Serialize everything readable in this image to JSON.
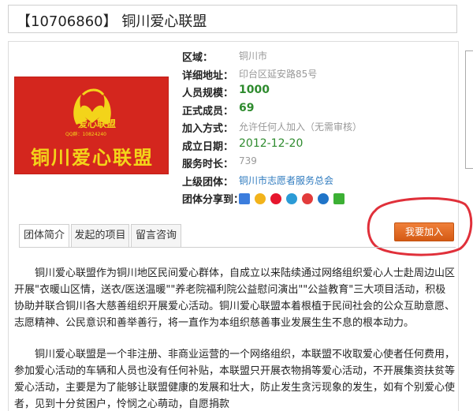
{
  "header": {
    "title": "【10706860】 铜川爱心联盟"
  },
  "logo": {
    "brand_main": "铜川爱心联盟",
    "brand_small": "爱心联盟",
    "qq": "QQ群：10824240"
  },
  "info": {
    "rows": [
      {
        "key": "区域：",
        "value": "铜川市"
      },
      {
        "key": "详细地址：",
        "value": "印台区延安路85号"
      },
      {
        "key": "人员规模：",
        "value": "1000"
      },
      {
        "key": "正式成员：",
        "value": "69"
      },
      {
        "key": "加入方式：",
        "value": "允许任何人加入（无需审核）"
      },
      {
        "key": "成立日期：",
        "value": "2012-12-20"
      },
      {
        "key": "服务时长：",
        "value": "739"
      },
      {
        "key": "上级团体：",
        "value": "铜川市志愿者服务总会"
      },
      {
        "key": "团体分享到：",
        "value": ""
      }
    ]
  },
  "share_icons": [
    "qzone-icon",
    "star-icon",
    "weibo-icon",
    "tencent-weibo-icon",
    "renren-icon",
    "kaixin-icon",
    "wechat-icon"
  ],
  "actions": {
    "join_label": "我要加入"
  },
  "tabs": [
    {
      "label": "团体简介",
      "active": true
    },
    {
      "label": "发起的项目",
      "active": false
    },
    {
      "label": "留言咨询",
      "active": false
    }
  ],
  "description": {
    "paragraphs": [
      "铜川爱心联盟作为铜川地区民间爱心群体，自成立以来陆续通过网络组织爱心人士赴周边山区开展\"衣暖山区情，送衣/医送温暖\"\"养老院福利院公益慰问演出\"\"公益教育\"三大项目活动，积极协助并联合铜川各大慈善组织开展爱心活动。铜川爱心联盟本着根植于民间社会的公众互助意愿、志愿精神、公民意识和善举善行，将一直作为本组织慈善事业发展生生不息的根本动力。",
      "铜川爱心联盟是一个非注册、非商业运营的一个网络组织，本联盟不收取爱心使者任何费用，参加爱心活动的车辆和人员也没有任何补贴，本联盟只开展衣物捐等爱心活动，不开展集资扶贫等爱心活动，主要是为了能够让联盟健康的发展和壮大，防止发生贪污现象的发生，如有个别爱心使者，见到十分贫困户，怜悯之心萌动，自愿捐款"
    ]
  },
  "colors": {
    "logo_red": "#d4261e",
    "logo_yellow": "#f3d41a",
    "join_orange": "#e2691f",
    "value_green": "#2e8b2e",
    "link_blue": "#2f7bbf",
    "annotation_red": "#e0303a"
  }
}
